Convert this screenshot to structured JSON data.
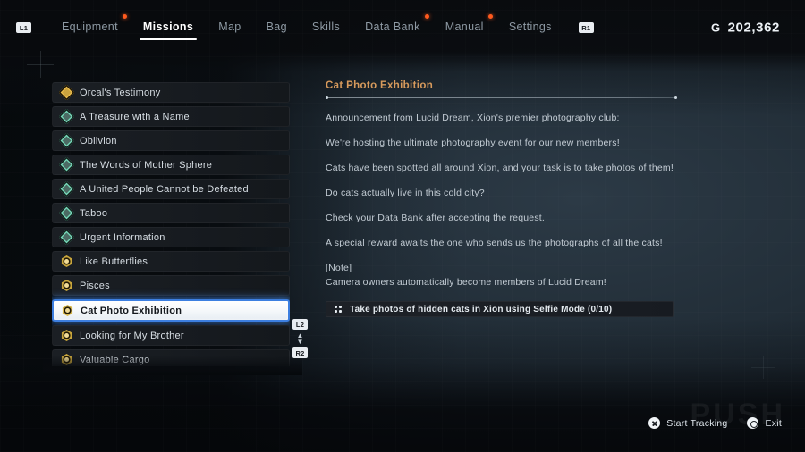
{
  "topbar": {
    "left_key": "L1",
    "right_key": "R1",
    "nav": [
      {
        "label": "Equipment",
        "active": false,
        "dot": true
      },
      {
        "label": "Missions",
        "active": true,
        "dot": false
      },
      {
        "label": "Map",
        "active": false,
        "dot": false
      },
      {
        "label": "Bag",
        "active": false,
        "dot": false
      },
      {
        "label": "Skills",
        "active": false,
        "dot": false
      },
      {
        "label": "Data Bank",
        "active": false,
        "dot": true
      },
      {
        "label": "Manual",
        "active": false,
        "dot": true
      },
      {
        "label": "Settings",
        "active": false,
        "dot": false
      }
    ],
    "currency_symbol": "G",
    "currency_amount": "202,362"
  },
  "mission_list": {
    "scroll_up_key": "L2",
    "scroll_down_key": "R2",
    "scroll_arrows": "▲\n▼",
    "items": [
      {
        "label": "Orcal's Testimony",
        "icon": "diamond-gold",
        "selected": false
      },
      {
        "label": "A Treasure with a Name",
        "icon": "diamond-teal",
        "selected": false
      },
      {
        "label": "Oblivion",
        "icon": "diamond-teal",
        "selected": false
      },
      {
        "label": "The Words of Mother Sphere",
        "icon": "diamond-teal",
        "selected": false
      },
      {
        "label": "A United People Cannot be Defeated",
        "icon": "diamond-teal",
        "selected": false
      },
      {
        "label": "Taboo",
        "icon": "diamond-teal",
        "selected": false
      },
      {
        "label": "Urgent Information",
        "icon": "diamond-teal",
        "selected": false
      },
      {
        "label": "Like Butterflies",
        "icon": "hex-gold",
        "selected": false
      },
      {
        "label": "Pisces",
        "icon": "hex-gold",
        "selected": false
      },
      {
        "label": "Cat Photo Exhibition",
        "icon": "hex-gold",
        "selected": true
      },
      {
        "label": "Looking for My Brother",
        "icon": "hex-gold",
        "selected": false
      },
      {
        "label": "Valuable Cargo",
        "icon": "hex-gold",
        "selected": false
      }
    ]
  },
  "detail": {
    "title": "Cat Photo Exhibition",
    "paragraphs": [
      "Announcement from Lucid Dream, Xion's premier photography club:",
      "We're hosting the ultimate photography event for our new members!",
      "Cats have been spotted all around Xion, and your task is to take photos of them!",
      "Do cats actually live in this cold city?",
      "Check your Data Bank after accepting the request.",
      "A special reward awaits the one who sends us the photographs of all the cats!"
    ],
    "note_header": "[Note]",
    "note_body": "Camera owners automatically become members of Lucid Dream!",
    "objective": "Take photos of hidden cats in Xion using Selfie Mode (0/10)"
  },
  "actions": [
    {
      "label": "Start Tracking",
      "glyph": "cross-button-icon"
    },
    {
      "label": "Exit",
      "glyph": "circle-button-icon"
    }
  ],
  "watermark": "PUSH",
  "colors": {
    "accent_title": "#d79a5c",
    "notification_dot": "#ff5a1e",
    "selection_border": "#3d7fe0",
    "icon_gold": "#caa33f",
    "icon_teal": "#74d8b8",
    "text_primary": "#e4eaef",
    "text_body": "#c3ccd4",
    "text_muted": "#8e9aa4"
  }
}
